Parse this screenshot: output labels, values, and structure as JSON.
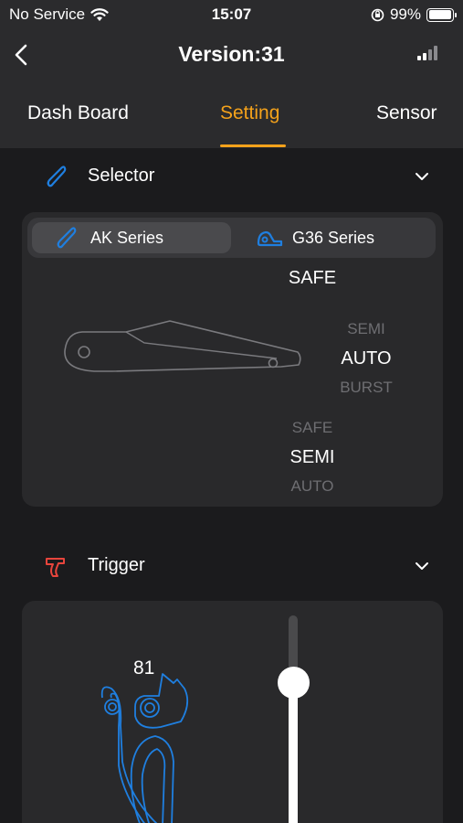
{
  "status_bar": {
    "carrier": "No Service",
    "time": "15:07",
    "battery": "99%",
    "battery_level": 0.99
  },
  "nav": {
    "title": "Version:31",
    "back_icon": "chevron-left-icon",
    "signal_icon": "signal-bars-icon"
  },
  "tabs": [
    {
      "label": "Dash Board"
    },
    {
      "label": "Setting"
    },
    {
      "label": "Sensor"
    }
  ],
  "active_tab": "Setting",
  "selector": {
    "title": "Selector",
    "icon": "selector-lever-icon",
    "segments": [
      {
        "label": "AK Series",
        "icon": "ak-lever-icon",
        "selected": true
      },
      {
        "label": "G36 Series",
        "icon": "g36-lever-icon",
        "selected": false
      }
    ],
    "wheel_top": {
      "current": "SAFE"
    },
    "wheel_middle": {
      "previous": "SEMI",
      "current": "AUTO",
      "next": "BURST"
    },
    "wheel_bottom": {
      "previous": "SAFE",
      "current": "SEMI",
      "next": "AUTO"
    }
  },
  "trigger": {
    "title": "Trigger",
    "icon": "trigger-icon",
    "value": "81"
  },
  "colors": {
    "accent": "#f4a21b",
    "blue": "#1f7fe0",
    "red": "#e8453c",
    "background": "#1b1b1d",
    "card": "#29292b"
  }
}
